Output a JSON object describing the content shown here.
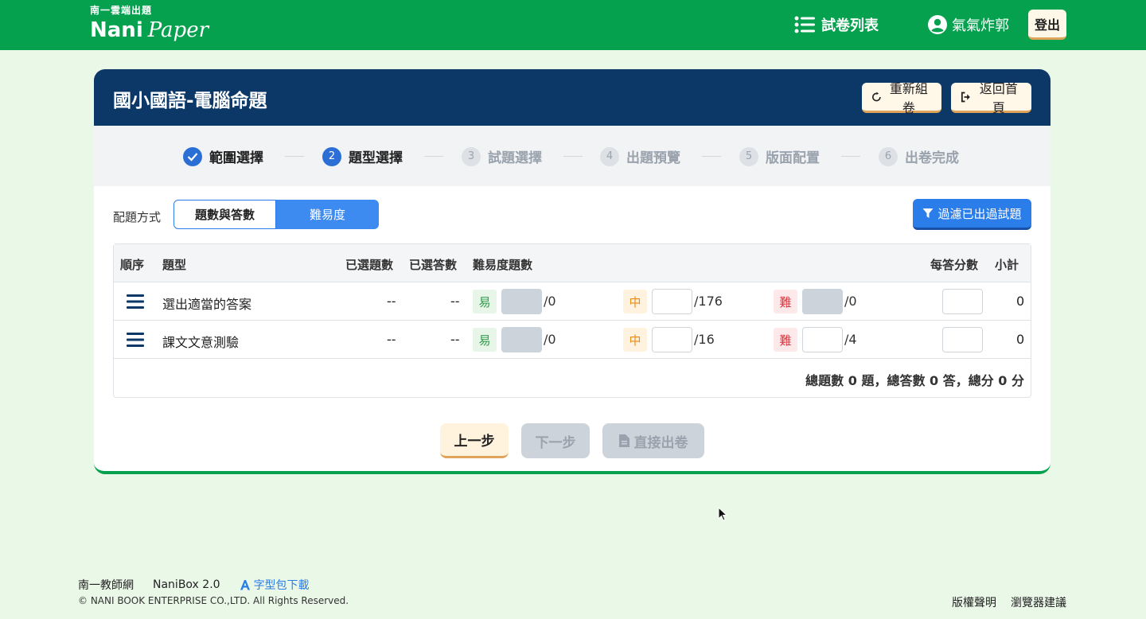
{
  "header": {
    "logo_sub": "南一雲端出題",
    "logo_nani": "Nani",
    "logo_paper": "Paper",
    "nav_list_label": "試卷列表",
    "user_name": "氣氣炸郭",
    "logout_label": "登出"
  },
  "card": {
    "title": "國小國語-電腦命題",
    "reset_label": "重新組卷",
    "home_label": "返回首頁"
  },
  "steps": [
    {
      "num": "1",
      "label": "範圍選擇",
      "state": "done"
    },
    {
      "num": "2",
      "label": "題型選擇",
      "state": "active"
    },
    {
      "num": "3",
      "label": "試題選擇",
      "state": "todo"
    },
    {
      "num": "4",
      "label": "出題預覽",
      "state": "todo"
    },
    {
      "num": "5",
      "label": "版面配置",
      "state": "todo"
    },
    {
      "num": "6",
      "label": "出卷完成",
      "state": "todo"
    }
  ],
  "mode": {
    "label": "配題方式",
    "option_a": "題數與答數",
    "option_b": "難易度",
    "selected": "難易度"
  },
  "filter_label": "過濾已出過試題",
  "table": {
    "headers": {
      "order": "順序",
      "type": "題型",
      "selected_q": "已選題數",
      "selected_a": "已選答數",
      "difficulty": "難易度題數",
      "score_per": "每答分數",
      "subtotal": "小計"
    },
    "tags": {
      "easy": "易",
      "mid": "中",
      "hard": "難"
    },
    "rows": [
      {
        "name": "選出適當的答案",
        "selected_q": "--",
        "selected_a": "--",
        "easy_max": "/0",
        "mid_max": "/176",
        "hard_max": "/0",
        "subtotal": "0"
      },
      {
        "name": "課文文意測驗",
        "selected_q": "--",
        "selected_a": "--",
        "easy_max": "/0",
        "mid_max": "/16",
        "hard_max": "/4",
        "subtotal": "0"
      }
    ],
    "summary": "總題數 0 題，總答數 0 答，總分 0 分"
  },
  "buttons": {
    "prev": "上一步",
    "next": "下一步",
    "direct": "直接出卷"
  },
  "footer": {
    "link1": "南一教師網",
    "link2": "NaniBox 2.0",
    "font_download": "字型包下載",
    "copyright": "© NANI BOOK ENTERPRISE CO.,LTD. All Rights Reserved.",
    "copyright_notice": "版權聲明",
    "browser_advice": "瀏覽器建議"
  },
  "colors": {
    "brand_green": "#05a14e",
    "navy": "#0b3866",
    "accent_blue": "#2b7de9"
  }
}
